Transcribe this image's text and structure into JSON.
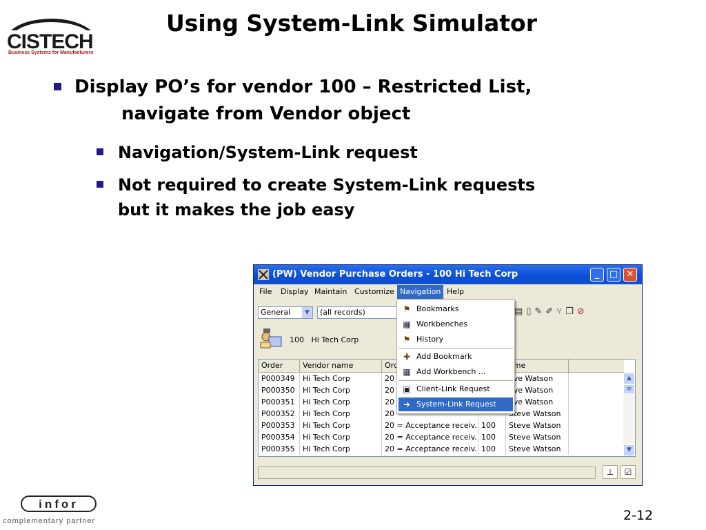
{
  "slide": {
    "title": "Using System-Link Simulator",
    "logo_text": "CISTECH",
    "logo_tagline": "Business Systems for Manufacturers",
    "bullet1_line1": "Display PO’s for vendor 100 – Restricted List,",
    "bullet1_line2": "navigate from Vendor object",
    "bullet2": "Navigation/System-Link request",
    "bullet3_line1": "Not required to create System-Link requests",
    "bullet3_line2": "but it makes the job easy",
    "footer_partner": "complementary partner",
    "page_number": "2-12",
    "infor_logo_text": "infor"
  },
  "window": {
    "title": "(PW) Vendor Purchase Orders - 100   Hi Tech Corp",
    "menus": [
      "File",
      "Display",
      "Maintain",
      "Customize",
      "Navigation",
      "Help"
    ],
    "active_menu": "Navigation",
    "view_select": "General",
    "records_select": "(all records)",
    "vendor_id": "100",
    "vendor_name": "Hi Tech Corp",
    "columns": [
      "Order",
      "Vendor name",
      "Ord",
      "",
      "ame"
    ],
    "rows": [
      [
        "P000349",
        "Hi Tech Corp",
        "20",
        "",
        "eve Watson"
      ],
      [
        "P000350",
        "Hi Tech Corp",
        "20",
        "",
        "eve Watson"
      ],
      [
        "P000351",
        "Hi Tech Corp",
        "20",
        "",
        "eve Watson"
      ],
      [
        "P000352",
        "Hi Tech Corp",
        "20",
        "",
        "Steve Watson"
      ],
      [
        "P000353",
        "Hi Tech Corp",
        "20 = Acceptance receiv...",
        "100",
        "Steve Watson"
      ],
      [
        "P000354",
        "Hi Tech Corp",
        "20 = Acceptance receiv...",
        "100",
        "Steve Watson"
      ],
      [
        "P000355",
        "Hi Tech Corp",
        "20 = Acceptance receiv...",
        "100",
        "Steve Watson"
      ]
    ],
    "nav_menu": {
      "items": [
        "Bookmarks",
        "Workbenches",
        "History",
        "Add Bookmark",
        "Add Workbench ...",
        "Client-Link Request",
        "System-Link Request"
      ],
      "highlighted": "System-Link Request"
    }
  },
  "colors": {
    "titlebar": "#0a4ed8",
    "menu_highlight": "#316ac5",
    "bullet": "#1c1c8c",
    "logo_tagline": "#b01818"
  }
}
